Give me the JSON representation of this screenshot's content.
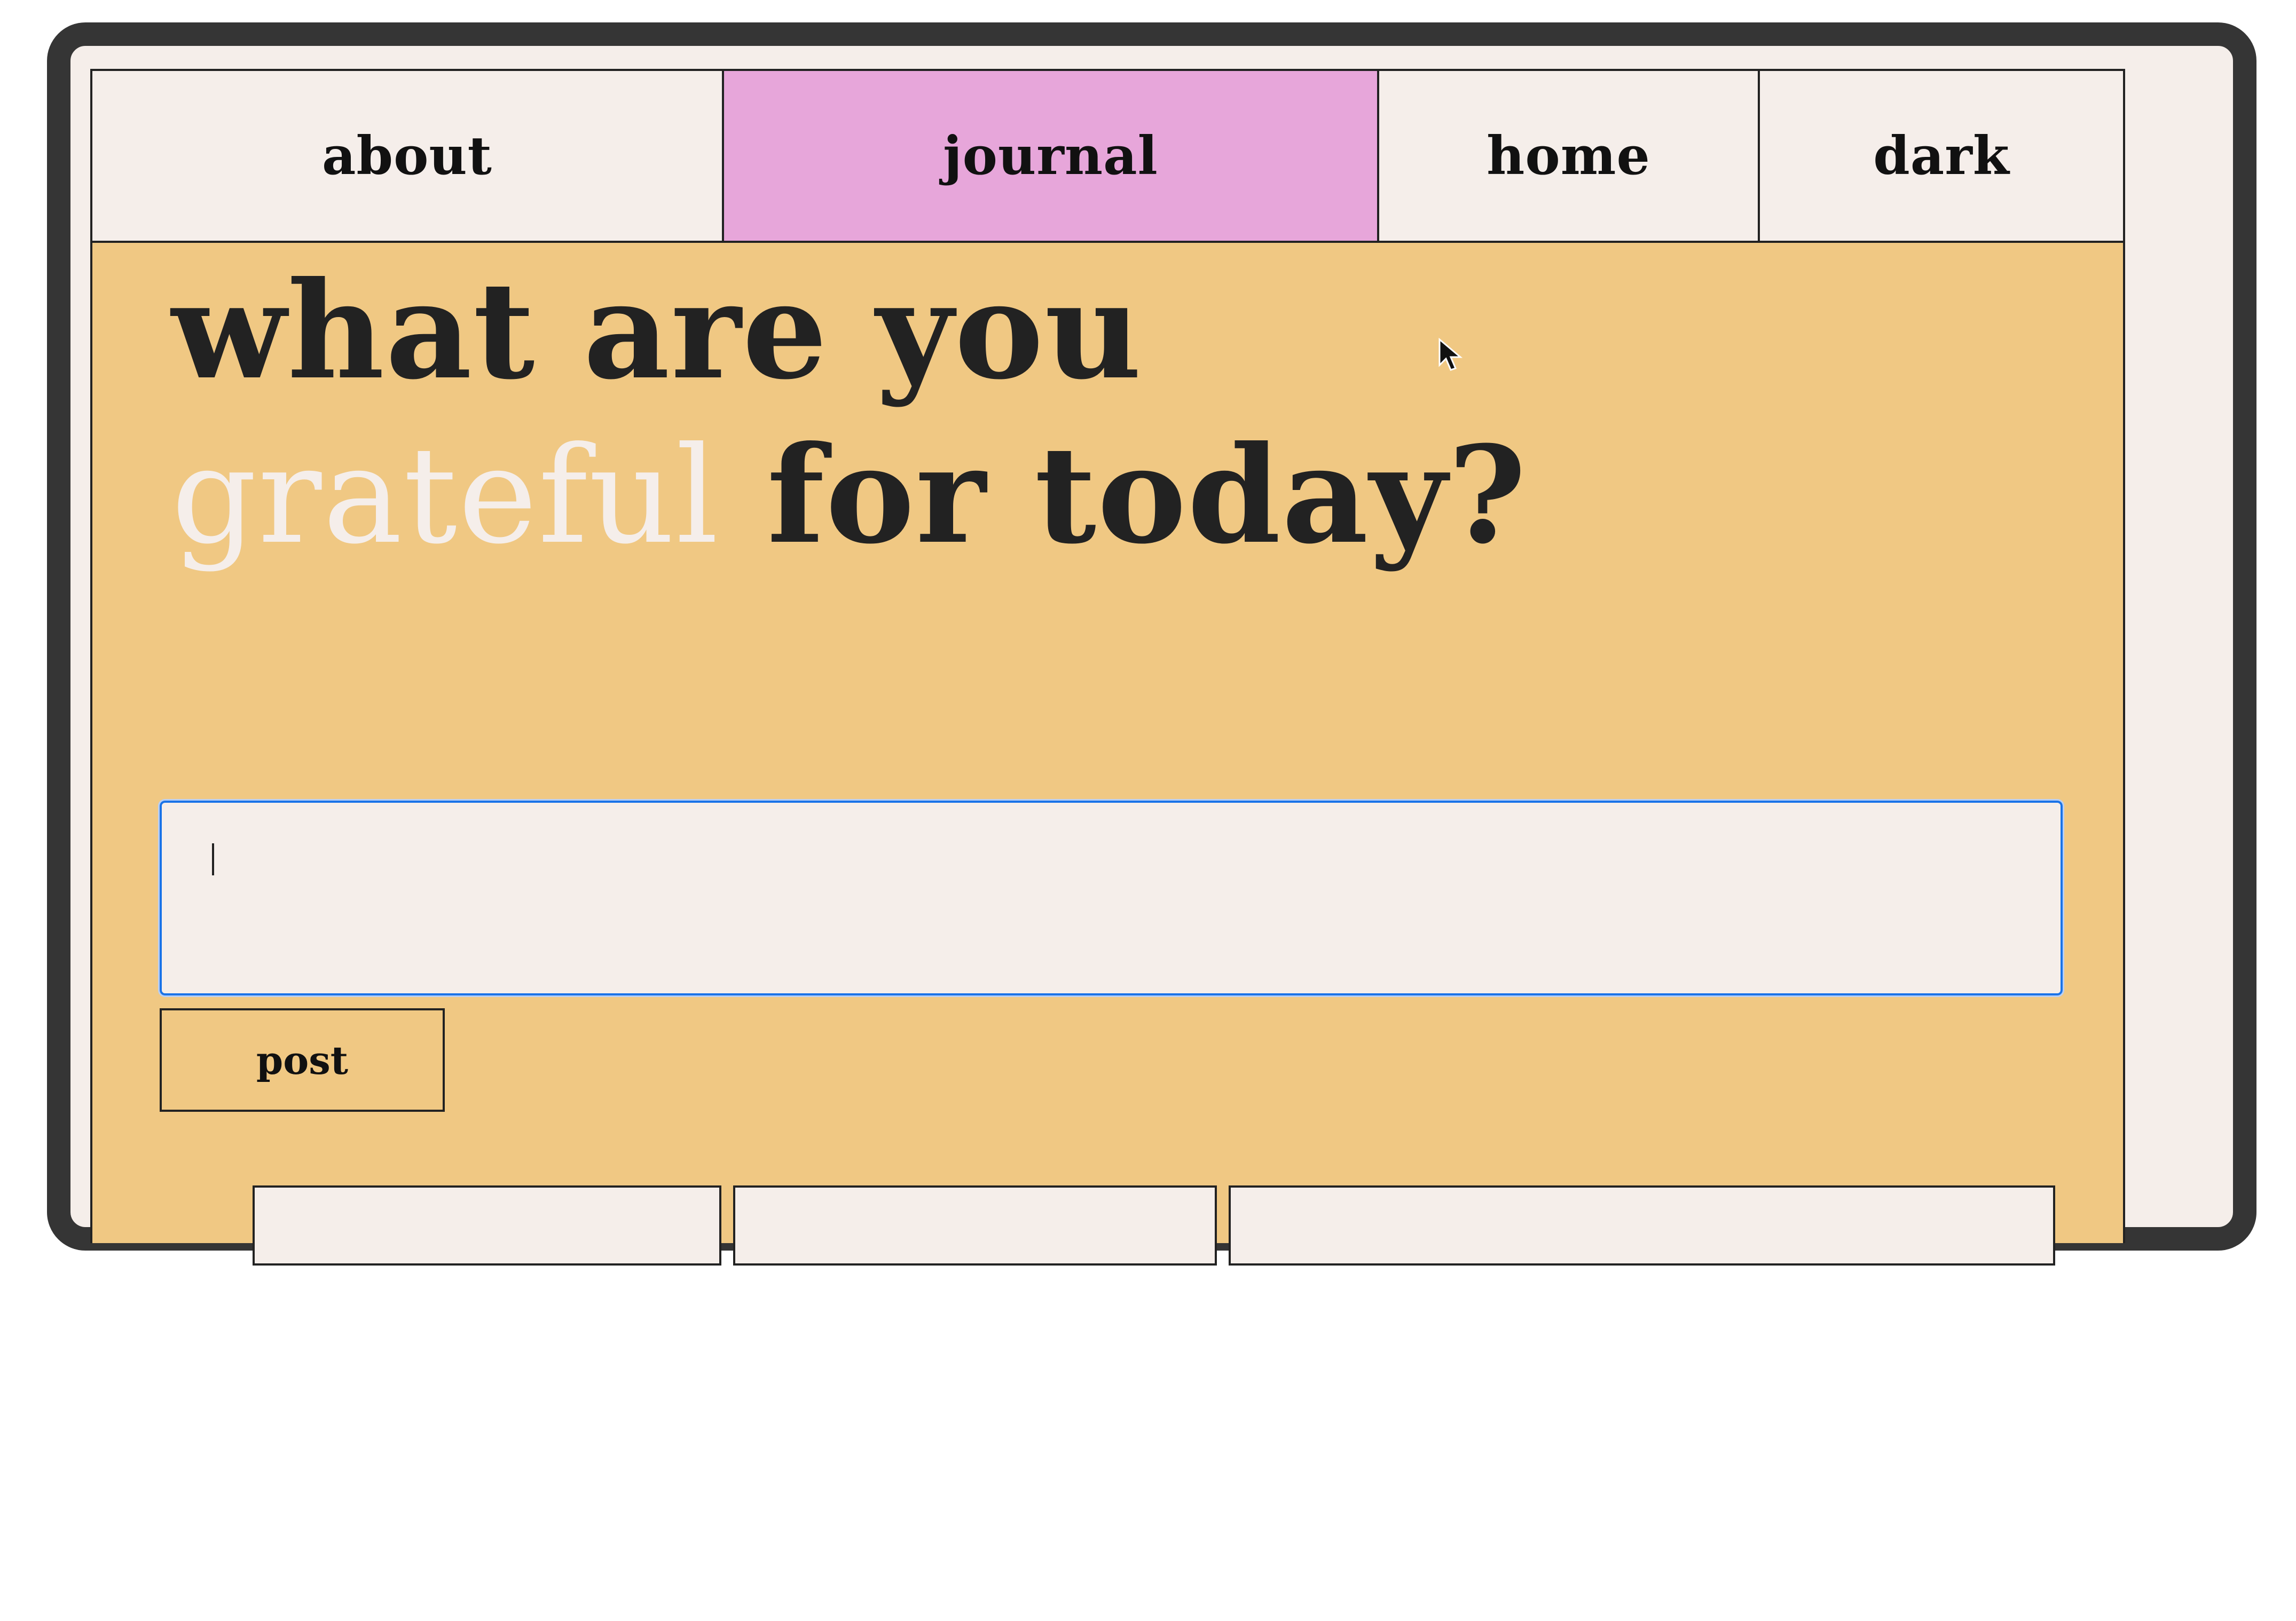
{
  "nav": {
    "items": [
      {
        "label": "about"
      },
      {
        "label": "journal",
        "active": true
      },
      {
        "label": "home"
      },
      {
        "label": "dark"
      }
    ]
  },
  "heading": {
    "line1": "what are you",
    "accent_word": "grateful",
    "line2_rest": " for today?"
  },
  "entry": {
    "value": "",
    "placeholder": ""
  },
  "post_button": {
    "label": "post"
  },
  "colors": {
    "frame": "#353535",
    "page_background": "#f5eeea",
    "content_background": "#f0c883",
    "active_tab": "#e7a6da",
    "text": "#222222",
    "accent_text": "#f5eeea",
    "focus_ring": "#1a73e8"
  }
}
